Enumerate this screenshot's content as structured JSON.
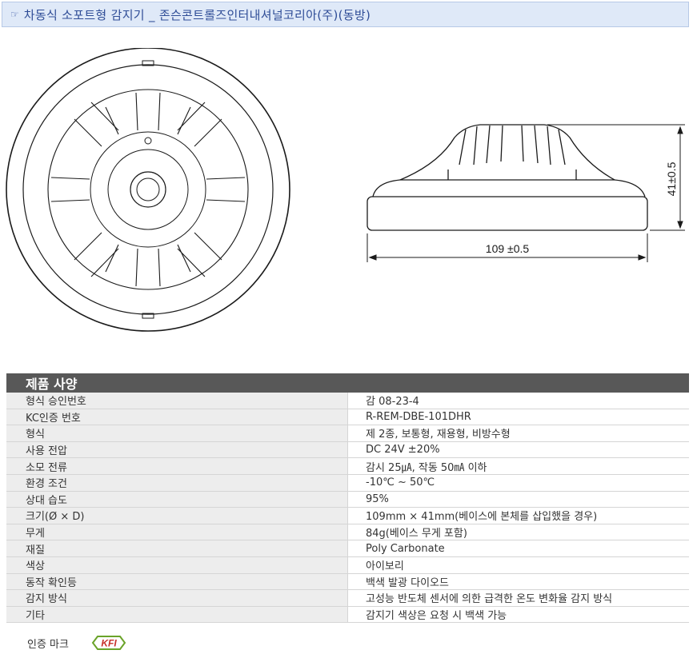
{
  "header": {
    "hand_icon": "pointing-hand-icon",
    "title": "차동식 소포트형 감지기 _ 존슨콘트롤즈인터내셔널코리아(주)(동방)"
  },
  "drawing": {
    "width_label": "109 ±0.5",
    "height_label": "41±0.5"
  },
  "spec": {
    "heading": "제품 사양",
    "rows": [
      {
        "k": "형식 승인번호",
        "v": "감 08-23-4"
      },
      {
        "k": "KC인증 번호",
        "v": "R-REM-DBE-101DHR"
      },
      {
        "k": "형식",
        "v": "제 2종, 보통형, 재용형, 비방수형"
      },
      {
        "k": "사용 전압",
        "v": "DC 24V ±20%"
      },
      {
        "k": "소모 전류",
        "v": "감시 25㎂, 작동 50㎃ 이하"
      },
      {
        "k": "환경 조건",
        "v": "-10℃ ~ 50℃"
      },
      {
        "k": "상대 습도",
        "v": "95%"
      },
      {
        "k": "크기(Ø × D)",
        "v": "109mm × 41mm(베이스에 본체를 삽입했을 경우)"
      },
      {
        "k": "무게",
        "v": "84g(베이스 무게 포함)"
      },
      {
        "k": "재질",
        "v": "Poly Carbonate"
      },
      {
        "k": "색상",
        "v": "아이보리"
      },
      {
        "k": "동작 확인등",
        "v": "백색 발광 다이오드"
      },
      {
        "k": "감지 방식",
        "v": "고성능 반도체 센서에 의한 급격한 온도 변화율 감지 방식"
      },
      {
        "k": "기타",
        "v": "감지기 색상은 요청 시 백색 가능"
      }
    ]
  },
  "cert": {
    "label": "인증 마크",
    "logo_text": "KFI"
  }
}
